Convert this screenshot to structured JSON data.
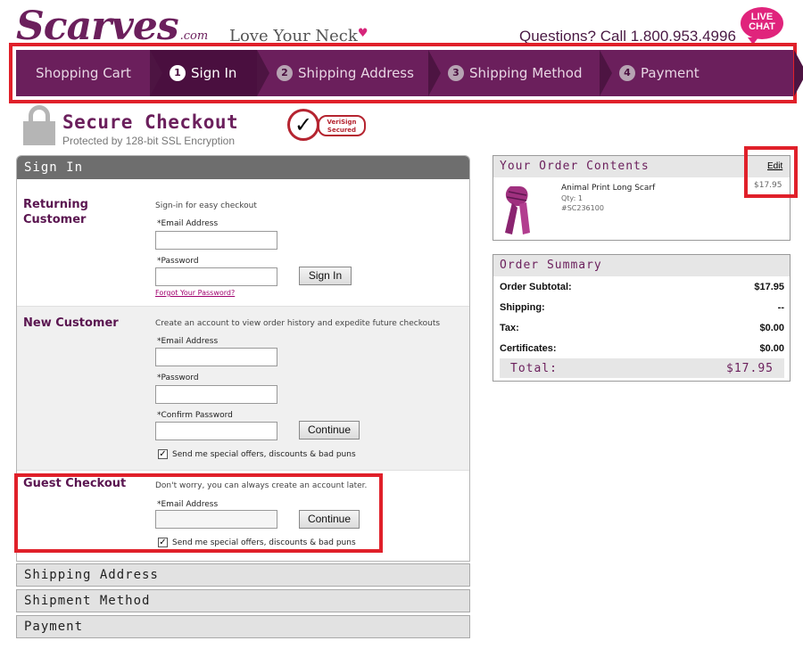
{
  "header": {
    "logo_word": "Scarves",
    "logo_suffix": ".com",
    "tagline": "Love Your Neck",
    "questions": "Questions? Call 1.800.953.4996",
    "live_chat_line1": "LIVE",
    "live_chat_line2": "CHAT"
  },
  "steps": [
    {
      "num": "",
      "label": "Shopping Cart"
    },
    {
      "num": "1",
      "label": "Sign In"
    },
    {
      "num": "2",
      "label": "Shipping Address"
    },
    {
      "num": "3",
      "label": "Shipping Method"
    },
    {
      "num": "4",
      "label": "Payment"
    }
  ],
  "active_step": "Sign In",
  "secure": {
    "title": "Secure Checkout",
    "subtitle": "Protected by 128-bit SSL Encryption",
    "badge_line1": "VeriSign",
    "badge_line2": "Secured"
  },
  "signin": {
    "header": "Sign In",
    "returning": {
      "title_line1": "Returning",
      "title_line2": "Customer",
      "desc": "Sign-in for easy checkout",
      "email_label": "*Email Address",
      "password_label": "*Password",
      "button": "Sign In",
      "forgot": "Forgot Your Password?"
    },
    "new_customer": {
      "title": "New Customer",
      "desc": "Create an account to view order history and expedite future checkouts",
      "email_label": "*Email Address",
      "password_label": "*Password",
      "confirm_label": "*Confirm Password",
      "button": "Continue",
      "offers": "Send me special offers, discounts & bad puns",
      "offers_checked": true
    },
    "guest": {
      "title": "Guest Checkout",
      "desc": "Don't worry, you can always create an account later.",
      "email_label": "*Email Address",
      "button": "Continue",
      "offers": "Send me special offers, discounts & bad puns",
      "offers_checked": true
    }
  },
  "collapsed_sections": [
    "Shipping Address",
    "Shipment Method",
    "Payment"
  ],
  "order_contents": {
    "header": "Your Order Contents",
    "edit": "Edit",
    "item_name": "Animal Print Long Scarf",
    "qty": "Qty: 1",
    "sku": "#SC236100",
    "price": "$17.95"
  },
  "order_summary": {
    "header": "Order Summary",
    "rows": [
      {
        "label": "Order Subtotal:",
        "value": "$17.95"
      },
      {
        "label": "Shipping:",
        "value": "--"
      },
      {
        "label": "Tax:",
        "value": "$0.00"
      },
      {
        "label": "Certificates:",
        "value": "$0.00"
      }
    ],
    "total_label": "Total:",
    "total_value": "$17.95"
  },
  "colors": {
    "brand_purple": "#6b1f5c",
    "highlight_red": "#e0202a",
    "live_chat_pink": "#e0247c"
  }
}
